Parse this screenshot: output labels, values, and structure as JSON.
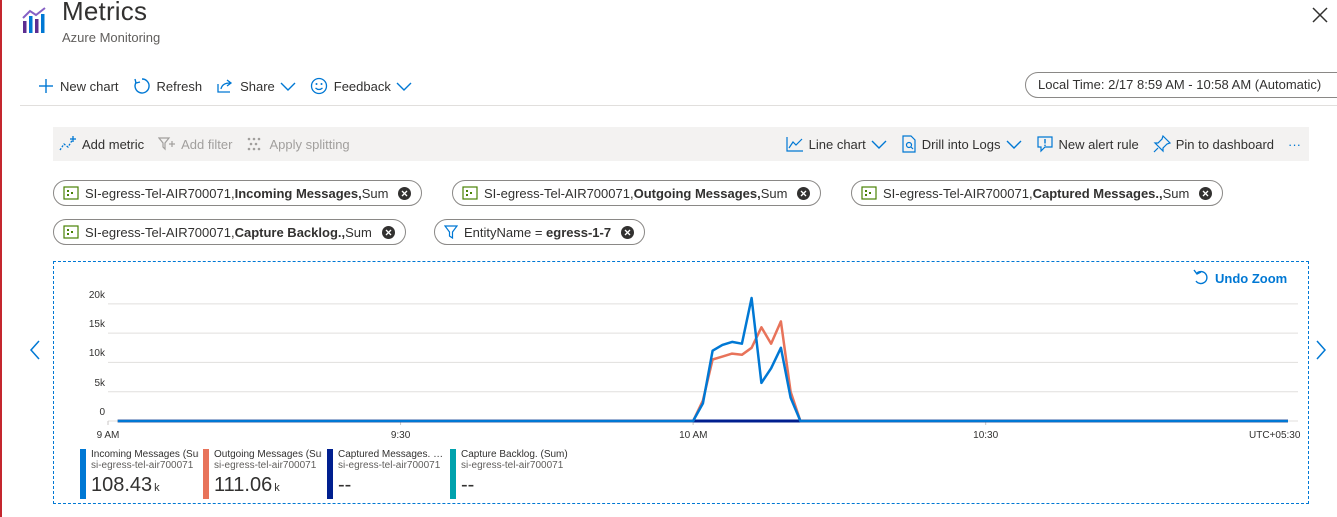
{
  "header": {
    "title": "Metrics",
    "subtitle": "Azure Monitoring"
  },
  "toolbar": {
    "new_chart": "New chart",
    "refresh": "Refresh",
    "share": "Share",
    "feedback": "Feedback",
    "time_range": "Local Time: 2/17 8:59 AM - 10:58 AM (Automatic)"
  },
  "chart_toolbar": {
    "add_metric": "Add metric",
    "add_filter": "Add filter",
    "apply_splitting": "Apply splitting",
    "line_chart": "Line chart",
    "drill_into_logs": "Drill into Logs",
    "new_alert_rule": "New alert rule",
    "pin_to_dashboard": "Pin to dashboard",
    "more": "···"
  },
  "pills": [
    {
      "resource": "SI-egress-Tel-AIR700071, ",
      "metric": "Incoming Messages,",
      "agg": " Sum"
    },
    {
      "resource": "SI-egress-Tel-AIR700071, ",
      "metric": "Outgoing Messages,",
      "agg": " Sum"
    },
    {
      "resource": "SI-egress-Tel-AIR700071, ",
      "metric": "Captured Messages.,",
      "agg": " Sum"
    },
    {
      "resource": "SI-egress-Tel-AIR700071, ",
      "metric": "Capture Backlog.,",
      "agg": " Sum"
    }
  ],
  "filter_pill": {
    "name": "EntityName",
    "op": " = ",
    "value": "egress-1-7"
  },
  "undo_zoom": "Undo Zoom",
  "colors": {
    "incoming": "#0078d4",
    "outgoing": "#e8735a",
    "captured": "#001f8f",
    "backlog": "#00a2ad",
    "accent": "#0078d4"
  },
  "chart_data": {
    "type": "line",
    "title": "",
    "xlabel": "",
    "ylabel": "",
    "ylim": [
      0,
      21000
    ],
    "y_ticks": [
      "20k",
      "15k",
      "10k",
      "5k",
      "0"
    ],
    "y_tick_values": [
      20000,
      15000,
      10000,
      5000,
      0
    ],
    "x_ticks": [
      "9 AM",
      "9:30",
      "10 AM",
      "10:30"
    ],
    "x_tick_minutes": [
      540,
      570,
      600,
      630
    ],
    "x_range_minutes": [
      540,
      661
    ],
    "timezone": "UTC+05:30",
    "series": [
      {
        "name": "Incoming Messages (Sum)",
        "resource": "si-egress-tel-air700071",
        "summary": "108.43",
        "summary_unit": "k",
        "points": [
          [
            541,
            0
          ],
          [
            600,
            0
          ],
          [
            601,
            3000
          ],
          [
            602,
            12000
          ],
          [
            603,
            13000
          ],
          [
            604,
            13500
          ],
          [
            605,
            13200
          ],
          [
            606,
            21000
          ],
          [
            607,
            6500
          ],
          [
            608,
            9000
          ],
          [
            609,
            12500
          ],
          [
            610,
            4000
          ],
          [
            611,
            0
          ],
          [
            661,
            0
          ]
        ]
      },
      {
        "name": "Outgoing Messages (Sum)",
        "resource": "si-egress-tel-air700071",
        "summary": "111.06",
        "summary_unit": "k",
        "points": [
          [
            541,
            0
          ],
          [
            600,
            0
          ],
          [
            601,
            3500
          ],
          [
            602,
            10500
          ],
          [
            603,
            11000
          ],
          [
            604,
            11500
          ],
          [
            605,
            11300
          ],
          [
            606,
            12500
          ],
          [
            607,
            16000
          ],
          [
            608,
            13200
          ],
          [
            609,
            17000
          ],
          [
            610,
            5000
          ],
          [
            611,
            0
          ],
          [
            661,
            0
          ]
        ]
      },
      {
        "name": "Captured Messages. (Sum)",
        "resource": "si-egress-tel-air700071",
        "summary": "--",
        "summary_unit": "",
        "points": [
          [
            541,
            0
          ],
          [
            661,
            0
          ]
        ]
      },
      {
        "name": "Capture Backlog. (Sum)",
        "resource": "si-egress-tel-air700071",
        "summary": "--",
        "summary_unit": "",
        "points": [
          [
            541,
            0
          ],
          [
            661,
            0
          ]
        ]
      }
    ]
  }
}
